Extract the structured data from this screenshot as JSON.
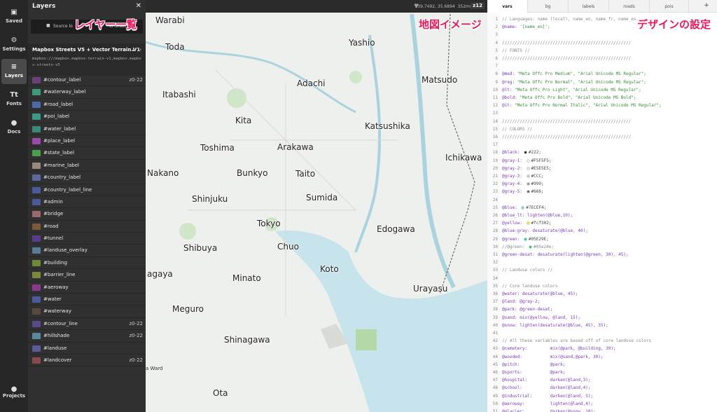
{
  "rail": {
    "saved": "Saved",
    "settings": "Settings",
    "layers": "Layers",
    "fonts": "Fonts",
    "docs": "Docs",
    "projects": "Projects"
  },
  "panel": {
    "title": "Layers",
    "source_lock_text": "Source lo",
    "source_lock_suffix": "er order)",
    "source_title": "Mapbox Streets V5 + Vector Terrain V1",
    "source_url": "mapbox:///mapbox.mapbox-terrain-v1,mapbox.mapbox-streets-v5"
  },
  "annotations": {
    "layers_list": "レイヤー一覧",
    "map_image": "地図イメージ",
    "design_settings": "デザインの設定"
  },
  "layers": [
    {
      "name": "#contour_label",
      "zoom": "z0-22",
      "color": "#6a3f7a"
    },
    {
      "name": "#waterway_label",
      "zoom": "",
      "color": "#3a9a7a"
    },
    {
      "name": "#road_label",
      "zoom": "",
      "color": "#4a6aa8"
    },
    {
      "name": "#poi_label",
      "zoom": "",
      "color": "#3a9a8a"
    },
    {
      "name": "#water_label",
      "zoom": "",
      "color": "#3a8a7a"
    },
    {
      "name": "#place_label",
      "zoom": "",
      "color": "#9a4aa8"
    },
    {
      "name": "#state_label",
      "zoom": "",
      "color": "#4aa04a"
    },
    {
      "name": "#marine_label",
      "zoom": "",
      "color": "#9a8878"
    },
    {
      "name": "#country_label",
      "zoom": "",
      "color": "#5a6aa0"
    },
    {
      "name": "#country_label_line",
      "zoom": "",
      "color": "#4a5a98"
    },
    {
      "name": "#admin",
      "zoom": "",
      "color": "#4a5a9a"
    },
    {
      "name": "#bridge",
      "zoom": "",
      "color": "#9a6a6a"
    },
    {
      "name": "#road",
      "zoom": "",
      "color": "#7a5a3a"
    },
    {
      "name": "#tunnel",
      "zoom": "",
      "color": "#5a3a8a"
    },
    {
      "name": "#landuse_overlay",
      "zoom": "",
      "color": "#5a7a9a"
    },
    {
      "name": "#building",
      "zoom": "",
      "color": "#6a8a3a"
    },
    {
      "name": "#barrier_line",
      "zoom": "",
      "color": "#7a8a3a"
    },
    {
      "name": "#aeroway",
      "zoom": "",
      "color": "#8a3a8a"
    },
    {
      "name": "#water",
      "zoom": "",
      "color": "#4a5a9a"
    },
    {
      "name": "#waterway",
      "zoom": "",
      "color": "#5a4a3a"
    },
    {
      "name": "#contour_line",
      "zoom": "z0-22",
      "color": "#5a4a8a"
    },
    {
      "name": "#hillshade",
      "zoom": "z0-22",
      "color": "#5a8a9a"
    },
    {
      "name": "#landuse",
      "zoom": "",
      "color": "#5a5a9a"
    },
    {
      "name": "#landcover",
      "zoom": "z0-22",
      "color": "#8a4a4a"
    }
  ],
  "map": {
    "coords": "139.7492, 35.6894",
    "ms": "352ms",
    "zoom": "z12",
    "places": [
      {
        "name": "Warabi"
      },
      {
        "name": "Toda"
      },
      {
        "name": "Yashio"
      },
      {
        "name": "Adachi"
      },
      {
        "name": "Matsudo"
      },
      {
        "name": "Itabashi"
      },
      {
        "name": "Kita"
      },
      {
        "name": "Katsushika"
      },
      {
        "name": "Toshima"
      },
      {
        "name": "Arakawa"
      },
      {
        "name": "Ichikawa"
      },
      {
        "name": "Nakano"
      },
      {
        "name": "Bunkyo"
      },
      {
        "name": "Taito"
      },
      {
        "name": "Shinjuku"
      },
      {
        "name": "Sumida"
      },
      {
        "name": "Tokyo"
      },
      {
        "name": "Edogawa"
      },
      {
        "name": "Shibuya"
      },
      {
        "name": "Chuo"
      },
      {
        "name": "Koto"
      },
      {
        "name": "agaya"
      },
      {
        "name": "Minato"
      },
      {
        "name": "Urayasu"
      },
      {
        "name": "Meguro"
      },
      {
        "name": "Shinagawa"
      },
      {
        "name": "Ota"
      },
      {
        "name": "a Ward"
      }
    ]
  },
  "editor": {
    "tabs": [
      "vars",
      "bg",
      "labels",
      "roads",
      "pois"
    ],
    "add": "+",
    "lines": [
      {
        "n": "1",
        "parts": [
          {
            "t": "// Languages: name (local), name_en, name_fr, name_es,",
            "c": "c-comment"
          }
        ]
      },
      {
        "n": "2",
        "parts": [
          {
            "t": "@name: ",
            "c": "c-var"
          },
          {
            "t": "'[name_en]';",
            "c": "c-str"
          }
        ]
      },
      {
        "n": "3",
        "parts": []
      },
      {
        "n": "4",
        "parts": [
          {
            "t": "///////////////////////////////////////////////////",
            "c": "c-comment"
          }
        ]
      },
      {
        "n": "5",
        "parts": [
          {
            "t": "// FONTS //",
            "c": "c-comment"
          }
        ]
      },
      {
        "n": "6",
        "parts": [
          {
            "t": "///////////////////////////////////////////////////",
            "c": "c-comment"
          }
        ]
      },
      {
        "n": "7",
        "parts": []
      },
      {
        "n": "8",
        "parts": [
          {
            "t": "@med: ",
            "c": "c-var"
          },
          {
            "t": "\"Meta Offc Pro Medium\", \"Arial Unicode MS Regular\";",
            "c": "c-str"
          }
        ]
      },
      {
        "n": "9",
        "parts": [
          {
            "t": "@reg: ",
            "c": "c-var"
          },
          {
            "t": "\"Meta Offc Pro Normal\", \"Arial Unicode MS Regular\";",
            "c": "c-str"
          }
        ]
      },
      {
        "n": "10",
        "parts": [
          {
            "t": "@lt: ",
            "c": "c-var"
          },
          {
            "t": "\"Meta Offc Pro Light\", \"Arial Unicode MS Regular\";",
            "c": "c-str"
          }
        ]
      },
      {
        "n": "11",
        "parts": [
          {
            "t": "@bold: ",
            "c": "c-var"
          },
          {
            "t": "\"Meta Offc Pro Bold\", \"Arial Unicode MS Bold\";",
            "c": "c-str"
          }
        ]
      },
      {
        "n": "12",
        "parts": [
          {
            "t": "@it: ",
            "c": "c-var"
          },
          {
            "t": "\"Meta Offc Pro Normal Italic\", \"Arial Unicode MS Regular\";",
            "c": "c-str"
          }
        ]
      },
      {
        "n": "13",
        "parts": []
      },
      {
        "n": "14",
        "parts": [
          {
            "t": "///////////////////////////////////////////////////",
            "c": "c-comment"
          }
        ]
      },
      {
        "n": "15",
        "parts": [
          {
            "t": "// COLORS //",
            "c": "c-comment"
          }
        ]
      },
      {
        "n": "16",
        "parts": [
          {
            "t": "///////////////////////////////////////////////////",
            "c": "c-comment"
          }
        ]
      },
      {
        "n": "17",
        "parts": []
      },
      {
        "n": "18",
        "parts": [
          {
            "t": "@black: ",
            "c": "c-var"
          },
          {
            "dot": "#222222"
          },
          {
            "t": "#222;",
            "c": ""
          }
        ]
      },
      {
        "n": "19",
        "parts": [
          {
            "t": "@gray-1: ",
            "c": "c-var"
          },
          {
            "dot": "#F5F5F5"
          },
          {
            "t": "#F5F5F5;",
            "c": ""
          }
        ]
      },
      {
        "n": "20",
        "parts": [
          {
            "t": "@gray-2: ",
            "c": "c-var"
          },
          {
            "dot": "#E5E5E5"
          },
          {
            "t": "#E5E5E5;",
            "c": ""
          }
        ]
      },
      {
        "n": "21",
        "parts": [
          {
            "t": "@gray-3: ",
            "c": "c-var"
          },
          {
            "dot": "#CCCCCC"
          },
          {
            "t": "#CCC;",
            "c": ""
          }
        ]
      },
      {
        "n": "22",
        "parts": [
          {
            "t": "@gray-4: ",
            "c": "c-var"
          },
          {
            "dot": "#999999"
          },
          {
            "t": "#999;",
            "c": ""
          }
        ]
      },
      {
        "n": "23",
        "parts": [
          {
            "t": "@gray-5: ",
            "c": "c-var"
          },
          {
            "dot": "#666666"
          },
          {
            "t": "#666;",
            "c": ""
          }
        ]
      },
      {
        "n": "24",
        "parts": []
      },
      {
        "n": "25",
        "parts": [
          {
            "t": "@blue: ",
            "c": "c-var"
          },
          {
            "dot": "#7ECEF4"
          },
          {
            "t": "#7ECEF4;",
            "c": ""
          }
        ]
      },
      {
        "n": "26",
        "parts": [
          {
            "t": "@blue_lt: lighten(@blue,10);",
            "c": "c-var"
          }
        ]
      },
      {
        "n": "27",
        "parts": [
          {
            "t": "@yellow: ",
            "c": "c-var"
          },
          {
            "dot": "#FCF302"
          },
          {
            "t": "#fcf302;",
            "c": ""
          }
        ]
      },
      {
        "n": "28",
        "parts": [
          {
            "t": "@blue-gray: desaturate(@blue, 40);",
            "c": "c-var"
          }
        ]
      },
      {
        "n": "29",
        "parts": [
          {
            "t": "@green: ",
            "c": "c-var"
          },
          {
            "dot": "#05E29E"
          },
          {
            "t": "#05E29E;",
            "c": ""
          }
        ]
      },
      {
        "n": "30",
        "parts": [
          {
            "t": "//@green: ",
            "c": "c-comment"
          },
          {
            "dot": "#05E24E"
          },
          {
            "t": "#05e24e;",
            "c": "c-comment"
          }
        ]
      },
      {
        "n": "31",
        "parts": [
          {
            "t": "@green-desat: desaturate(lighten(@green, 30), 45);",
            "c": "c-var"
          }
        ]
      },
      {
        "n": "32",
        "parts": []
      },
      {
        "n": "33",
        "parts": [
          {
            "t": "// Landuse colors //",
            "c": "c-comment"
          }
        ]
      },
      {
        "n": "34",
        "parts": []
      },
      {
        "n": "35",
        "parts": [
          {
            "t": "// Core landuse colors",
            "c": "c-comment"
          }
        ]
      },
      {
        "n": "36",
        "parts": [
          {
            "t": "@water: desaturate(@blue, 45);",
            "c": "c-var"
          }
        ]
      },
      {
        "n": "37",
        "parts": [
          {
            "t": "@land: @gray-2;",
            "c": "c-var"
          }
        ]
      },
      {
        "n": "38",
        "parts": [
          {
            "t": "@park: @green-desat;",
            "c": "c-var"
          }
        ]
      },
      {
        "n": "39",
        "parts": [
          {
            "t": "@sand: mix(@yellow, @land, 15);",
            "c": "c-var"
          }
        ]
      },
      {
        "n": "40",
        "parts": [
          {
            "t": "@snow: lighten(desaturate(@blue, 45), 35);",
            "c": "c-var"
          }
        ]
      },
      {
        "n": "41",
        "parts": []
      },
      {
        "n": "42",
        "parts": [
          {
            "t": "// All these variables are based off of core landuse colors",
            "c": "c-comment"
          }
        ]
      },
      {
        "n": "43",
        "parts": [
          {
            "t": "@cemetery:         mix(@park, @building, 30);",
            "c": "c-var"
          }
        ]
      },
      {
        "n": "44",
        "parts": [
          {
            "t": "@wooded:           mix(@sand,@park, 30);",
            "c": "c-var"
          }
        ]
      },
      {
        "n": "45",
        "parts": [
          {
            "t": "@pitch:            @park;",
            "c": "c-var"
          }
        ]
      },
      {
        "n": "46",
        "parts": [
          {
            "t": "@sports:           @park;",
            "c": "c-var"
          }
        ]
      },
      {
        "n": "47",
        "parts": [
          {
            "t": "@hospital:         darken(@land,3);",
            "c": "c-var"
          }
        ]
      },
      {
        "n": "48",
        "parts": [
          {
            "t": "@school:           darken(@land,4);",
            "c": "c-var"
          }
        ]
      },
      {
        "n": "49",
        "parts": [
          {
            "t": "@industrial:       darken(@land, 5);",
            "c": "c-var"
          }
        ]
      },
      {
        "n": "50",
        "parts": [
          {
            "t": "@aeroway:          lighten(@land,4);",
            "c": "c-var"
          }
        ]
      },
      {
        "n": "51",
        "parts": [
          {
            "t": "@glacier:          darken(@snow, 10);",
            "c": "c-var"
          }
        ]
      }
    ]
  }
}
